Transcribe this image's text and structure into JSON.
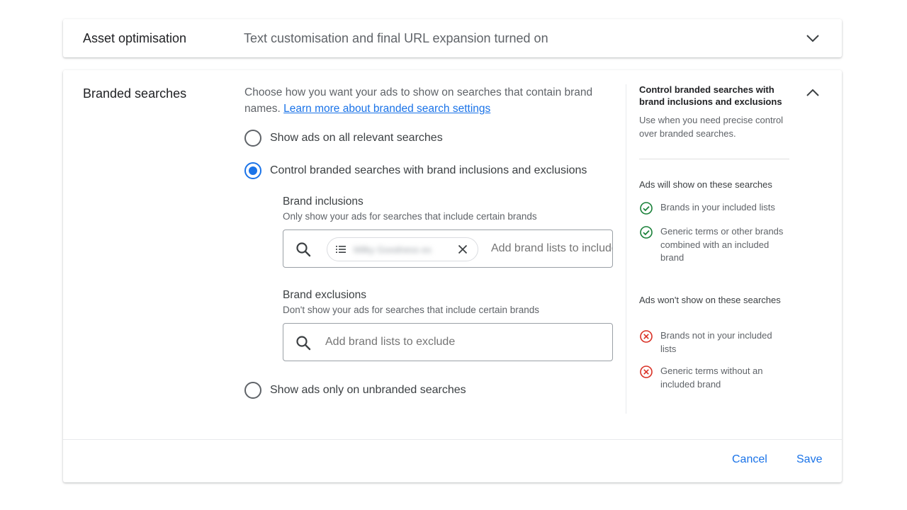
{
  "asset_optimisation": {
    "title": "Asset optimisation",
    "summary": "Text customisation and final URL expansion turned on",
    "expand_icon": "chevron-down-icon"
  },
  "branded_searches": {
    "title": "Branded searches",
    "collapse_icon": "chevron-up-icon",
    "description": "Choose how you want your ads to show on searches that contain brand names.",
    "learn_more_link": "Learn more about branded search settings",
    "options": [
      {
        "label": "Show ads on all relevant searches",
        "selected": false
      },
      {
        "label": "Control branded searches with brand inclusions and exclusions",
        "selected": true
      },
      {
        "label": "Show ads only on unbranded searches",
        "selected": false
      }
    ],
    "brand_inclusions": {
      "label": "Brand inclusions",
      "help": "Only show your ads for searches that include certain brands",
      "chip": "Milky Goodness ex",
      "placeholder": "Add brand lists to include"
    },
    "brand_exclusions": {
      "label": "Brand exclusions",
      "help": "Don't show your ads for searches that include certain brands",
      "placeholder": "Add brand lists to exclude"
    }
  },
  "side_panel": {
    "title": "Control branded searches with brand inclusions and exclusions",
    "subtitle": "Use when you need precise control over branded searches.",
    "will_show_heading": "Ads will show on these searches",
    "will_show_items": [
      "Brands in your included lists",
      "Generic terms or other brands combined with an included brand"
    ],
    "wont_show_heading": "Ads won't show on these searches",
    "wont_show_items": [
      "Brands not in your included lists",
      "Generic terms without an included brand"
    ]
  },
  "footer": {
    "cancel_label": "Cancel",
    "save_label": "Save"
  },
  "colors": {
    "accent": "#1a73e8",
    "success": "#188038",
    "error": "#d93025"
  }
}
